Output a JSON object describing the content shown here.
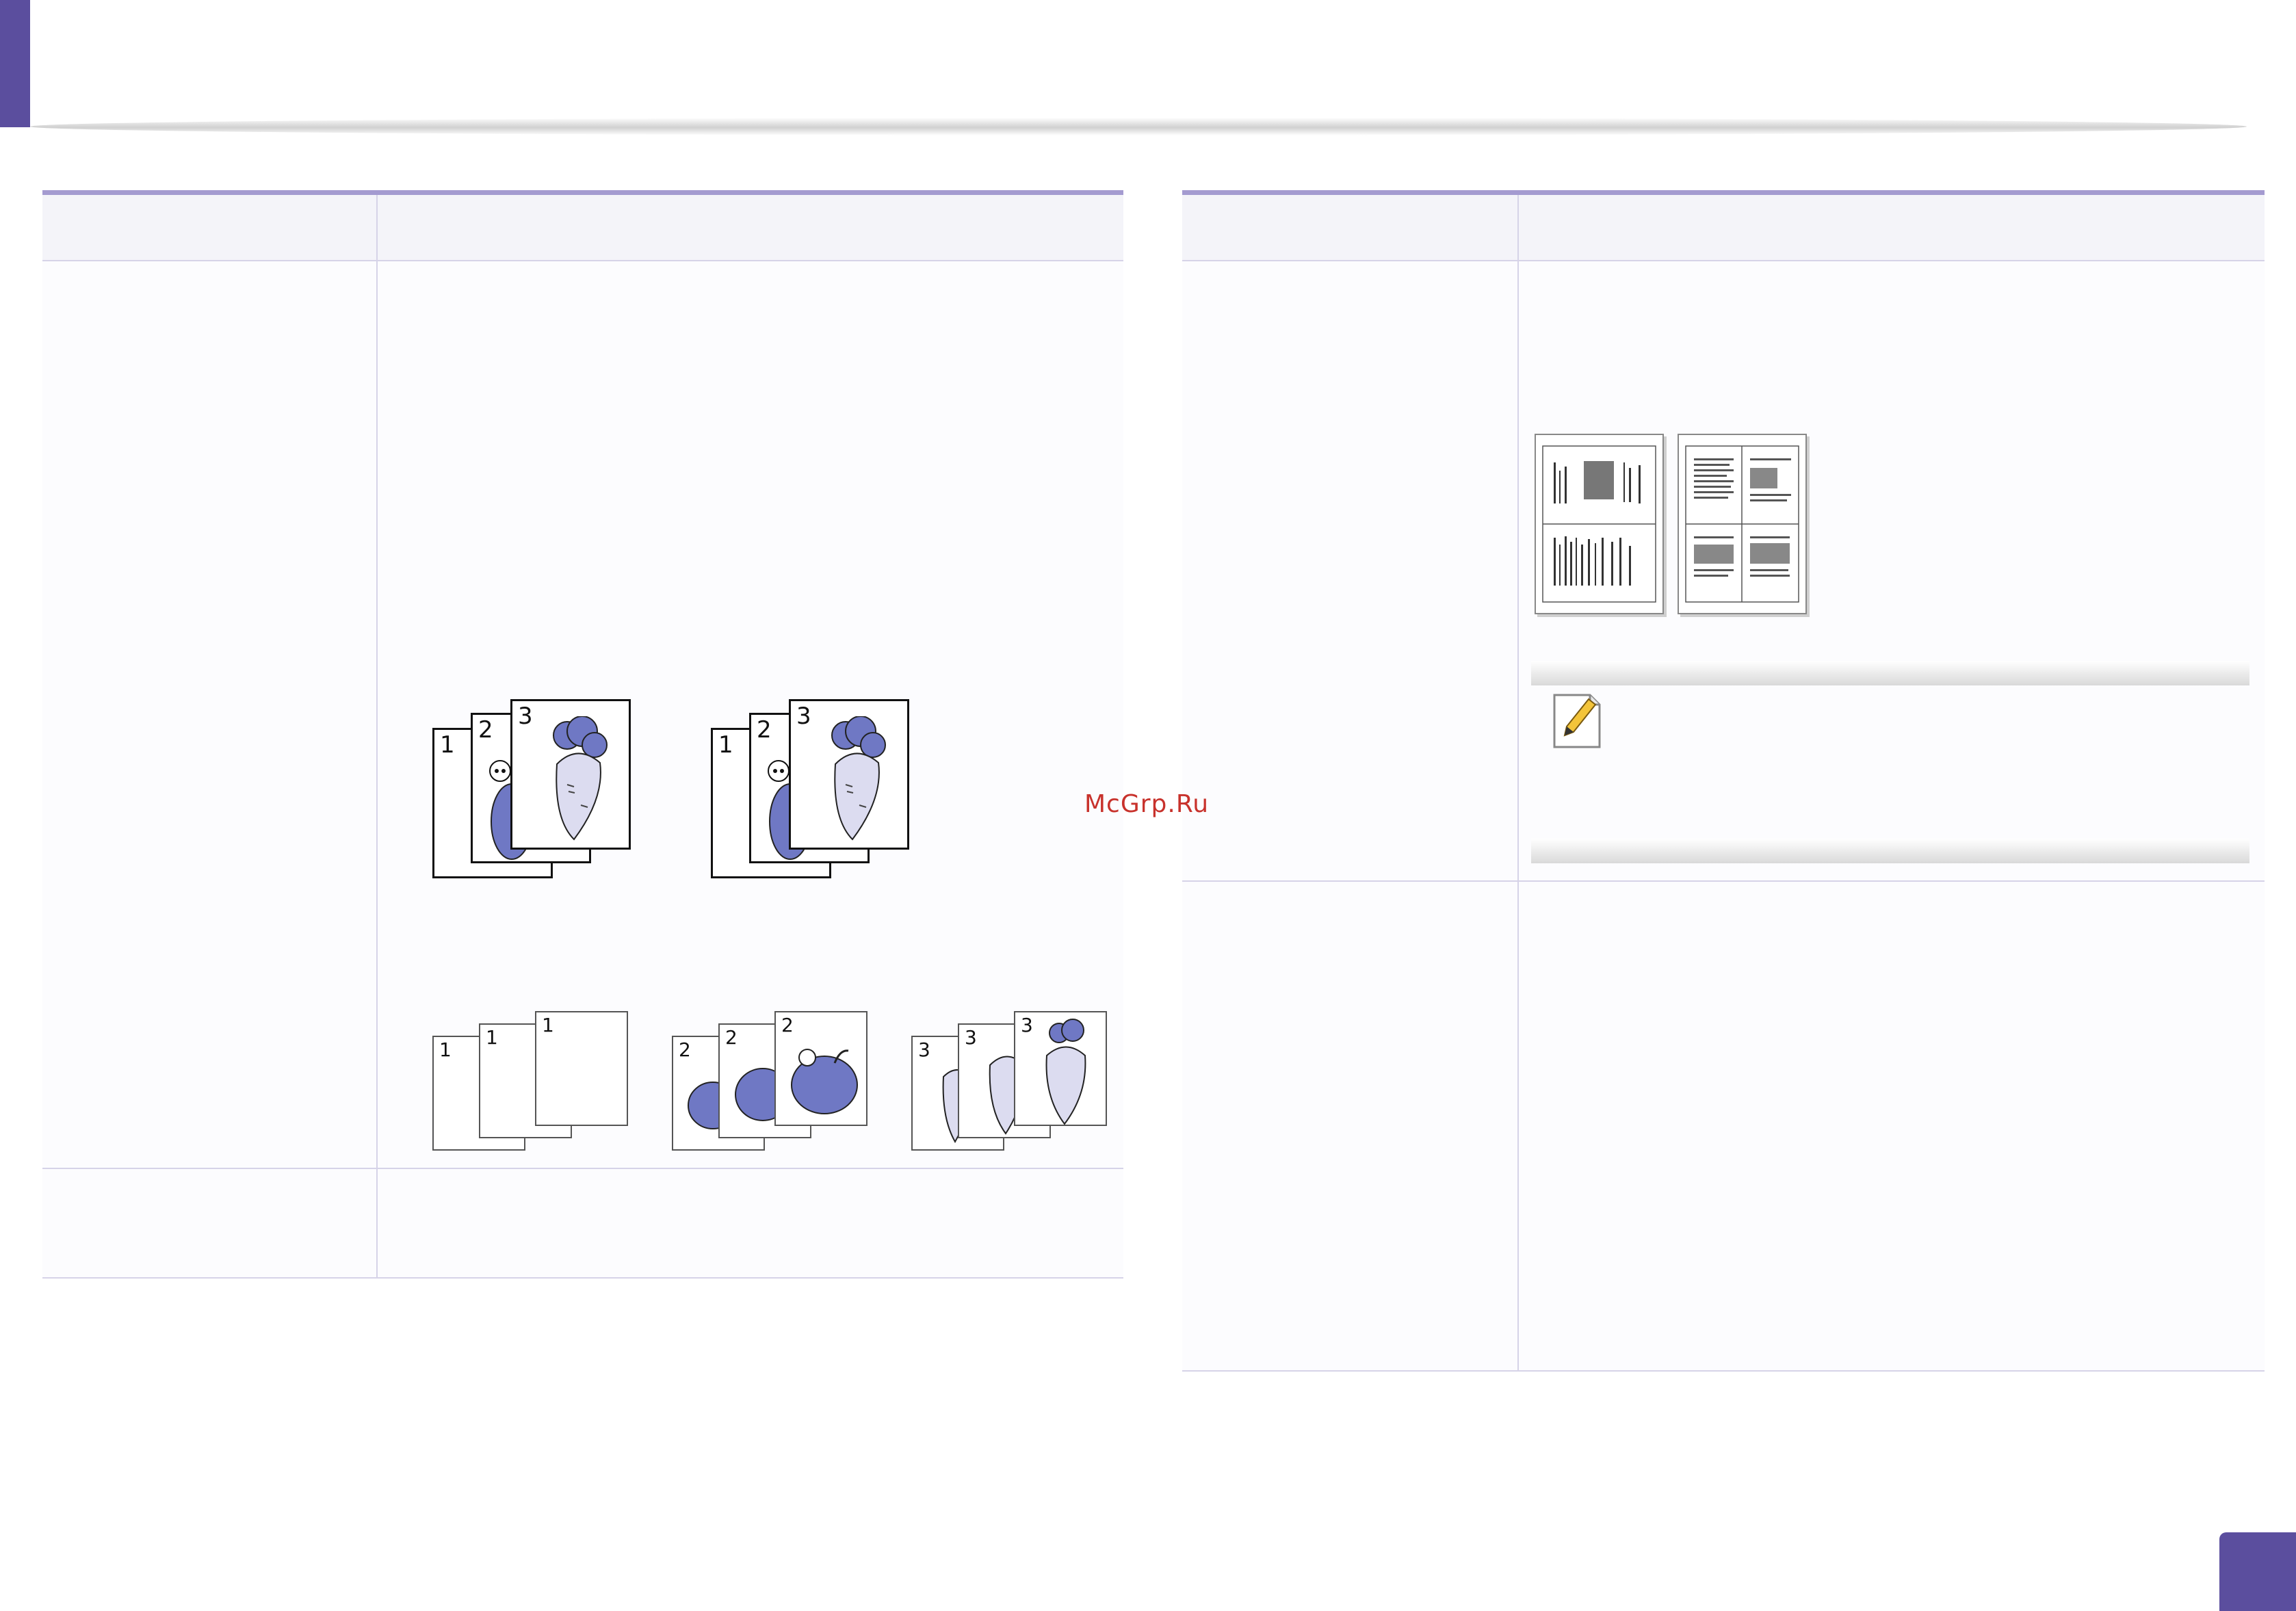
{
  "header": {
    "accent_color": "#5b4e9e"
  },
  "watermark": {
    "text": "McGrp.Ru"
  },
  "left_table": {
    "collate_row": {
      "collated_set": [
        "1",
        "2",
        "3"
      ],
      "collated_set_repeat": [
        "1",
        "2",
        "3"
      ],
      "uncollated_groups": [
        [
          "1",
          "1",
          "1"
        ],
        [
          "2",
          "2",
          "2"
        ],
        [
          "3",
          "3",
          "3"
        ]
      ]
    }
  },
  "right_table": {
    "note_icon": "note-pencil-icon"
  },
  "page_badge": {
    "color": "#5b4e9e"
  }
}
